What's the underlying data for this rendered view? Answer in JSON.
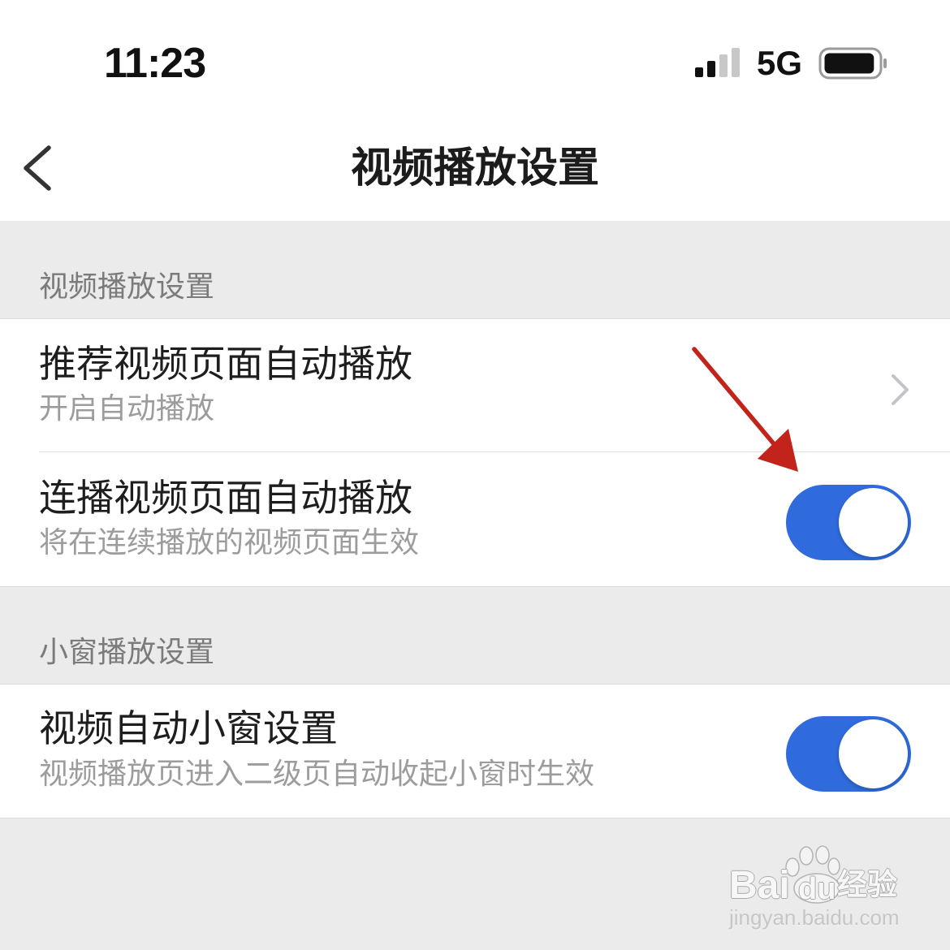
{
  "status_bar": {
    "time": "11:23",
    "network": "5G",
    "signal_level": 2,
    "battery_level": 0.95,
    "icons": {
      "signal": "cellular-signal-icon",
      "battery": "battery-icon"
    }
  },
  "nav": {
    "title": "视频播放设置",
    "back_icon": "chevron-left-icon"
  },
  "sections": [
    {
      "header": "视频播放设置",
      "rows": [
        {
          "title": "推荐视频页面自动播放",
          "subtitle": "开启自动播放",
          "accessory_icon": "chevron-right-icon"
        },
        {
          "title": "连播视频页面自动播放",
          "subtitle": "将在连续播放的视频页面生效",
          "toggle_on": true
        }
      ]
    },
    {
      "header": "小窗播放设置",
      "rows": [
        {
          "title": "视频自动小窗设置",
          "subtitle": "视频播放页进入二级页自动收起小窗时生效",
          "toggle_on": true
        }
      ]
    }
  ],
  "annotation": {
    "icon": "red-arrow-icon",
    "color": "#c2231b"
  },
  "watermark": {
    "brand_left": "Bai",
    "brand_right": "du",
    "product": "经验",
    "domain": "jingyan.baidu.com",
    "logo_icon": "baidu-paw-icon"
  },
  "colors": {
    "accent": "#2f6bdc",
    "background": "#ebebeb",
    "text_primary": "#1e1e1e",
    "text_secondary": "#9c9c9c"
  }
}
